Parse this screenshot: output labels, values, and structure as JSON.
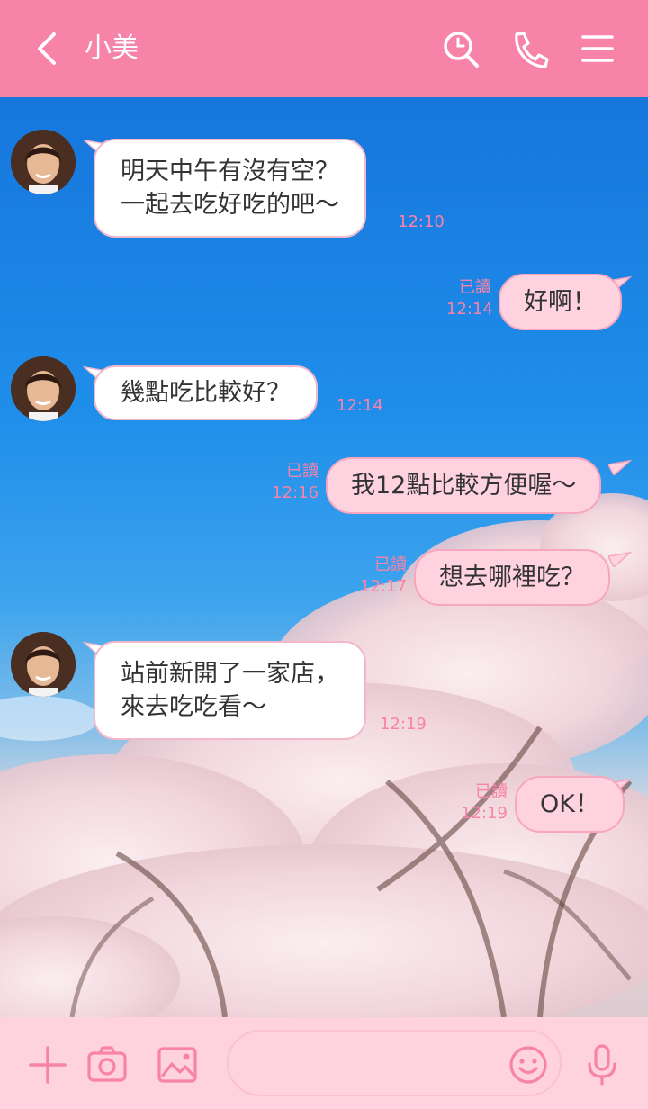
{
  "header": {
    "title": "小美",
    "icons": [
      "back-icon",
      "search-icon",
      "phone-icon",
      "menu-icon"
    ]
  },
  "colors": {
    "accent": "#f783a8",
    "outgoing_bubble": "#ffd2df",
    "incoming_bubble": "#ffffff",
    "footer": "#ffd2df"
  },
  "messages": [
    {
      "side": "in",
      "text": "明天中午有沒有空？\n一起去吃好吃的吧～",
      "time": "12:10"
    },
    {
      "side": "out",
      "text": "好啊！",
      "read": "已讀",
      "time": "12:14"
    },
    {
      "side": "in",
      "text": "幾點吃比較好？",
      "time": "12:14"
    },
    {
      "side": "out",
      "text": "我12點比較方便喔～",
      "read": "已讀",
      "time": "12:16"
    },
    {
      "side": "out",
      "text": "想去哪裡吃？",
      "read": "已讀",
      "time": "12:17"
    },
    {
      "side": "in",
      "text": "站前新開了一家店，\n來去吃吃看～",
      "time": "12:19"
    },
    {
      "side": "out",
      "text": "OK！",
      "read": "已讀",
      "time": "12:19"
    }
  ],
  "footer": {
    "icons": [
      "plus-icon",
      "camera-icon",
      "image-icon",
      "emoji-icon",
      "mic-icon"
    ],
    "input_placeholder": ""
  }
}
